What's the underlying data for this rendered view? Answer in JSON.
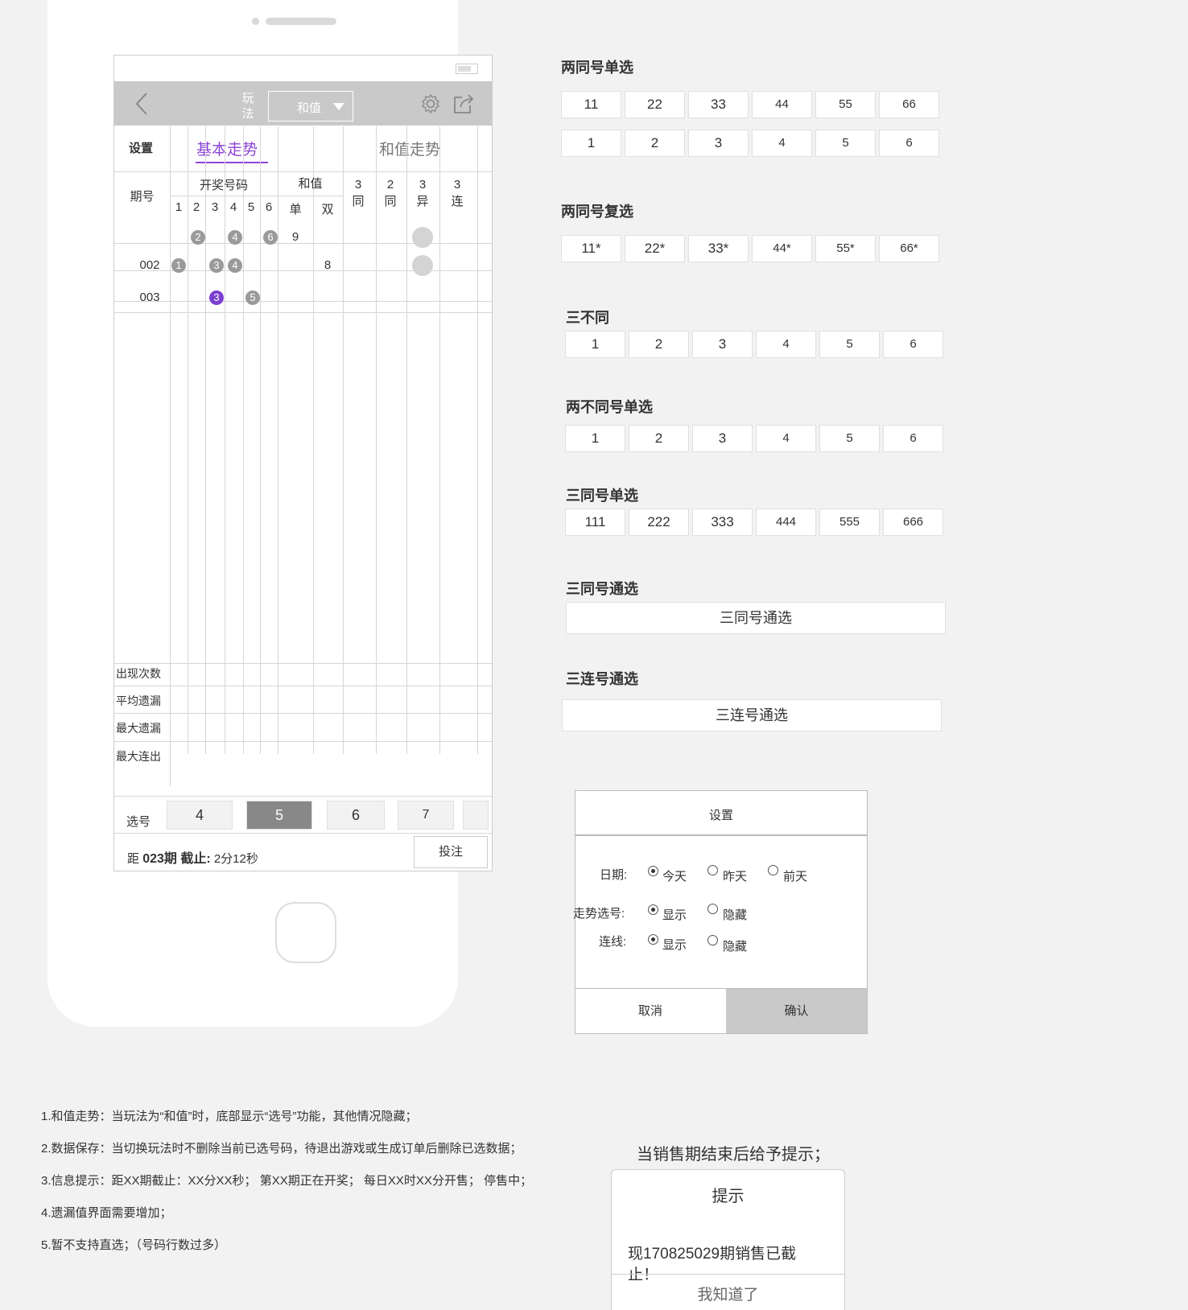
{
  "phone": {
    "nav": {
      "play_label": "玩\n法",
      "play_value": "和值"
    },
    "tabs": {
      "settings": "设置",
      "basic_trend": "基本走势",
      "sum_trend": "和值走势"
    },
    "table": {
      "issue_header": "期号",
      "draw_header": "开奖号码",
      "sum_header": "和值",
      "digit_cols": [
        "1",
        "2",
        "3",
        "4",
        "5",
        "6"
      ],
      "sum_cols": [
        "单",
        "双"
      ],
      "extra_cols": [
        "3\n同",
        "2\n同",
        "3\n异",
        "3\n连"
      ],
      "rows": [
        {
          "issue": "",
          "balls": [
            {
              "col": 2,
              "val": "2"
            },
            {
              "col": 4,
              "val": "4"
            },
            {
              "col": 6,
              "val": "6"
            }
          ],
          "odd": "9",
          "even": ""
        },
        {
          "issue": "002",
          "balls": [
            {
              "col": 1,
              "val": "1"
            },
            {
              "col": 3,
              "val": "3"
            },
            {
              "col": 4,
              "val": "4"
            }
          ],
          "odd": "",
          "even": "8"
        },
        {
          "issue": "003",
          "balls": [
            {
              "col": 3,
              "val": "3",
              "purple": true
            },
            {
              "col": 5,
              "val": "5"
            }
          ],
          "odd": "",
          "even": ""
        }
      ],
      "stats_labels": [
        "出现次数",
        "平均遗漏",
        "最大遗漏",
        "最大连出"
      ]
    },
    "picker": {
      "label": "选号",
      "options": [
        "4",
        "5",
        "6",
        "7"
      ],
      "selected": "5"
    },
    "footer": {
      "prefix": "距",
      "issue": "023期 截止:",
      "countdown": "2分12秒",
      "bet_button": "投注"
    }
  },
  "sections": {
    "two_same_single": {
      "title": "两同号单选",
      "row1": [
        "11",
        "22",
        "33",
        "44",
        "55",
        "66"
      ],
      "row2": [
        "1",
        "2",
        "3",
        "4",
        "5",
        "6"
      ]
    },
    "two_same_multi": {
      "title": "两同号复选",
      "row1": [
        "11*",
        "22*",
        "33*",
        "44*",
        "55*",
        "66*"
      ]
    },
    "three_diff": {
      "title": "三不同",
      "row1": [
        "1",
        "2",
        "3",
        "4",
        "5",
        "6"
      ]
    },
    "two_diff_single": {
      "title": "两不同号单选",
      "row1": [
        "1",
        "2",
        "3",
        "4",
        "5",
        "6"
      ]
    },
    "three_same_single": {
      "title": "三同号单选",
      "row1": [
        "111",
        "222",
        "333",
        "444",
        "555",
        "666"
      ]
    },
    "three_same_all": {
      "title": "三同号通选",
      "button": "三同号通选"
    },
    "three_seq_all": {
      "title": "三连号通选",
      "button": "三连号通选"
    }
  },
  "settings_dialog": {
    "title": "设置",
    "date_label": "日期:",
    "date_options": [
      "今天",
      "昨天",
      "前天"
    ],
    "trend_label": "走势选号:",
    "line_label": "连线:",
    "show": "显示",
    "hide": "隐藏",
    "cancel": "取消",
    "confirm": "确认"
  },
  "notes": [
    "1.和值走势：当玩法为“和值”时，底部显示“选号”功能，其他情况隐藏；",
    "2.数据保存：当切换玩法时不删除当前已选号码，待退出游戏或生成订单后删除已选数据；",
    "3.信息提示：距XX期截止：XX分XX秒；   第XX期正在开奖；    每日XX时XX分开售；   停售中；",
    "4.遗漏值界面需要增加；",
    "5.暂不支持直选；（号码行数过多）"
  ],
  "alert": {
    "caption": "当销售期结束后给予提示；",
    "title": "提示",
    "message": "现170825029期销售已截止！",
    "button": "我知道了"
  }
}
